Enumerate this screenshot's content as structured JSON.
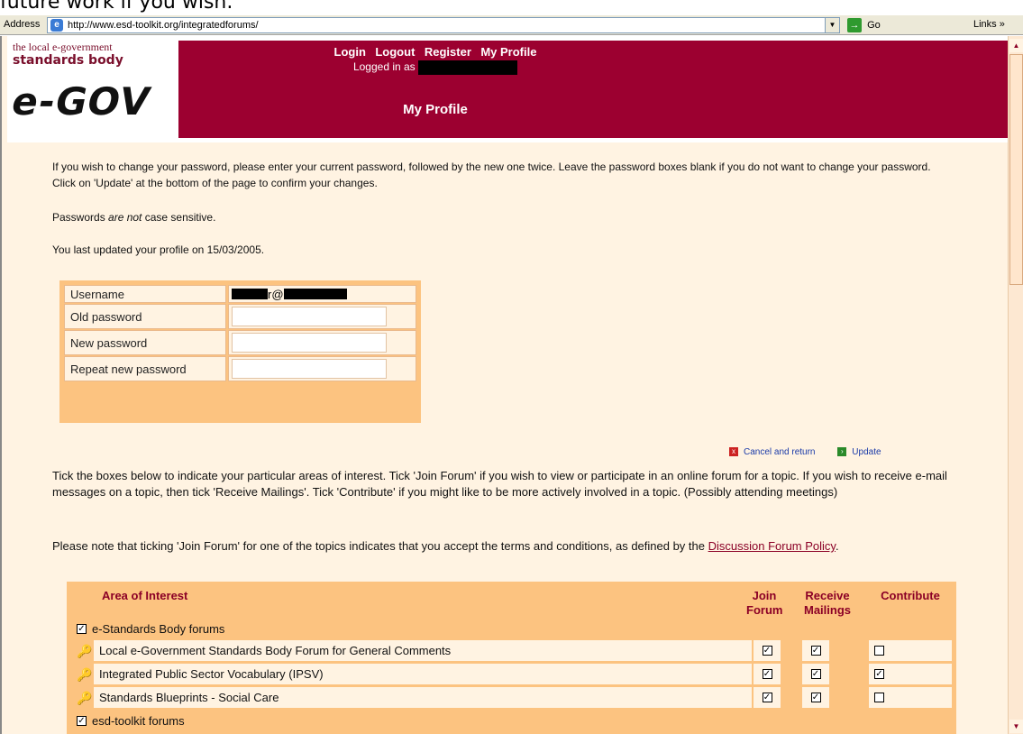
{
  "caption": "future work if you wish.",
  "browser": {
    "address_label": "Address",
    "url": "http://www.esd-toolkit.org/integratedforums/",
    "go_label": "Go",
    "links_label": "Links »"
  },
  "header": {
    "logo_line1": "the local e-government",
    "logo_line2": "standards body",
    "logo_mark": "e-GOV",
    "nav": [
      "Login",
      "Logout",
      "Register",
      "My Profile"
    ],
    "logged_in_label": "Logged in as",
    "page_title": "My Profile"
  },
  "content": {
    "intro": "If you wish to change your password, please enter your current password, followed by the new one twice. Leave the password boxes blank if you do not want to change your password. Click on 'Update' at the bottom of the page to confirm your changes.",
    "case_prefix": "Passwords ",
    "case_emph": "are not",
    "case_suffix": " case sensitive.",
    "last_updated": "You last updated your profile on 15/03/2005."
  },
  "credentials": {
    "username_label": "Username",
    "username_at": "r@",
    "old_password_label": "Old password",
    "new_password_label": "New password",
    "repeat_password_label": "Repeat new password"
  },
  "actions": {
    "cancel_label": "Cancel and return",
    "update_label": "Update"
  },
  "tick_instructions": "Tick the boxes below to indicate your particular areas of interest. Tick 'Join Forum' if you wish to view or participate in an online forum for a topic. If you wish to receive e-mail messages on a topic, then tick 'Receive Mailings'. Tick 'Contribute' if you might like to be more actively involved in a topic. (Possibly attending meetings)",
  "note": {
    "text": "Please note that ticking 'Join Forum' for one of the topics indicates that you accept the terms and conditions, as defined by the ",
    "link": "Discussion Forum Policy",
    "end": "."
  },
  "interest_table": {
    "col_area": "Area of Interest",
    "col_join_1": "Join",
    "col_join_2": "Forum",
    "col_receive_1": "Receive",
    "col_receive_2": "Mailings",
    "col_contribute": "Contribute",
    "groups": [
      {
        "label": "e-Standards Body forums",
        "checked": true,
        "items": [
          {
            "label": "Local e-Government Standards Body Forum for General Comments",
            "join": true,
            "receive": true,
            "contribute": false
          },
          {
            "label": "Integrated Public Sector Vocabulary (IPSV)",
            "join": true,
            "receive": true,
            "contribute": true
          },
          {
            "label": "Standards Blueprints - Social Care",
            "join": true,
            "receive": true,
            "contribute": false
          }
        ]
      },
      {
        "label": "esd-toolkit forums",
        "checked": true,
        "items": []
      }
    ]
  },
  "icons": {
    "checked_glyph": "✓",
    "item_glyph": "🔑",
    "scroll_up": "▲",
    "scroll_down": "▼",
    "dropdown": "▼",
    "go_arrow": "→",
    "cancel_glyph": "x",
    "update_glyph": "›"
  }
}
